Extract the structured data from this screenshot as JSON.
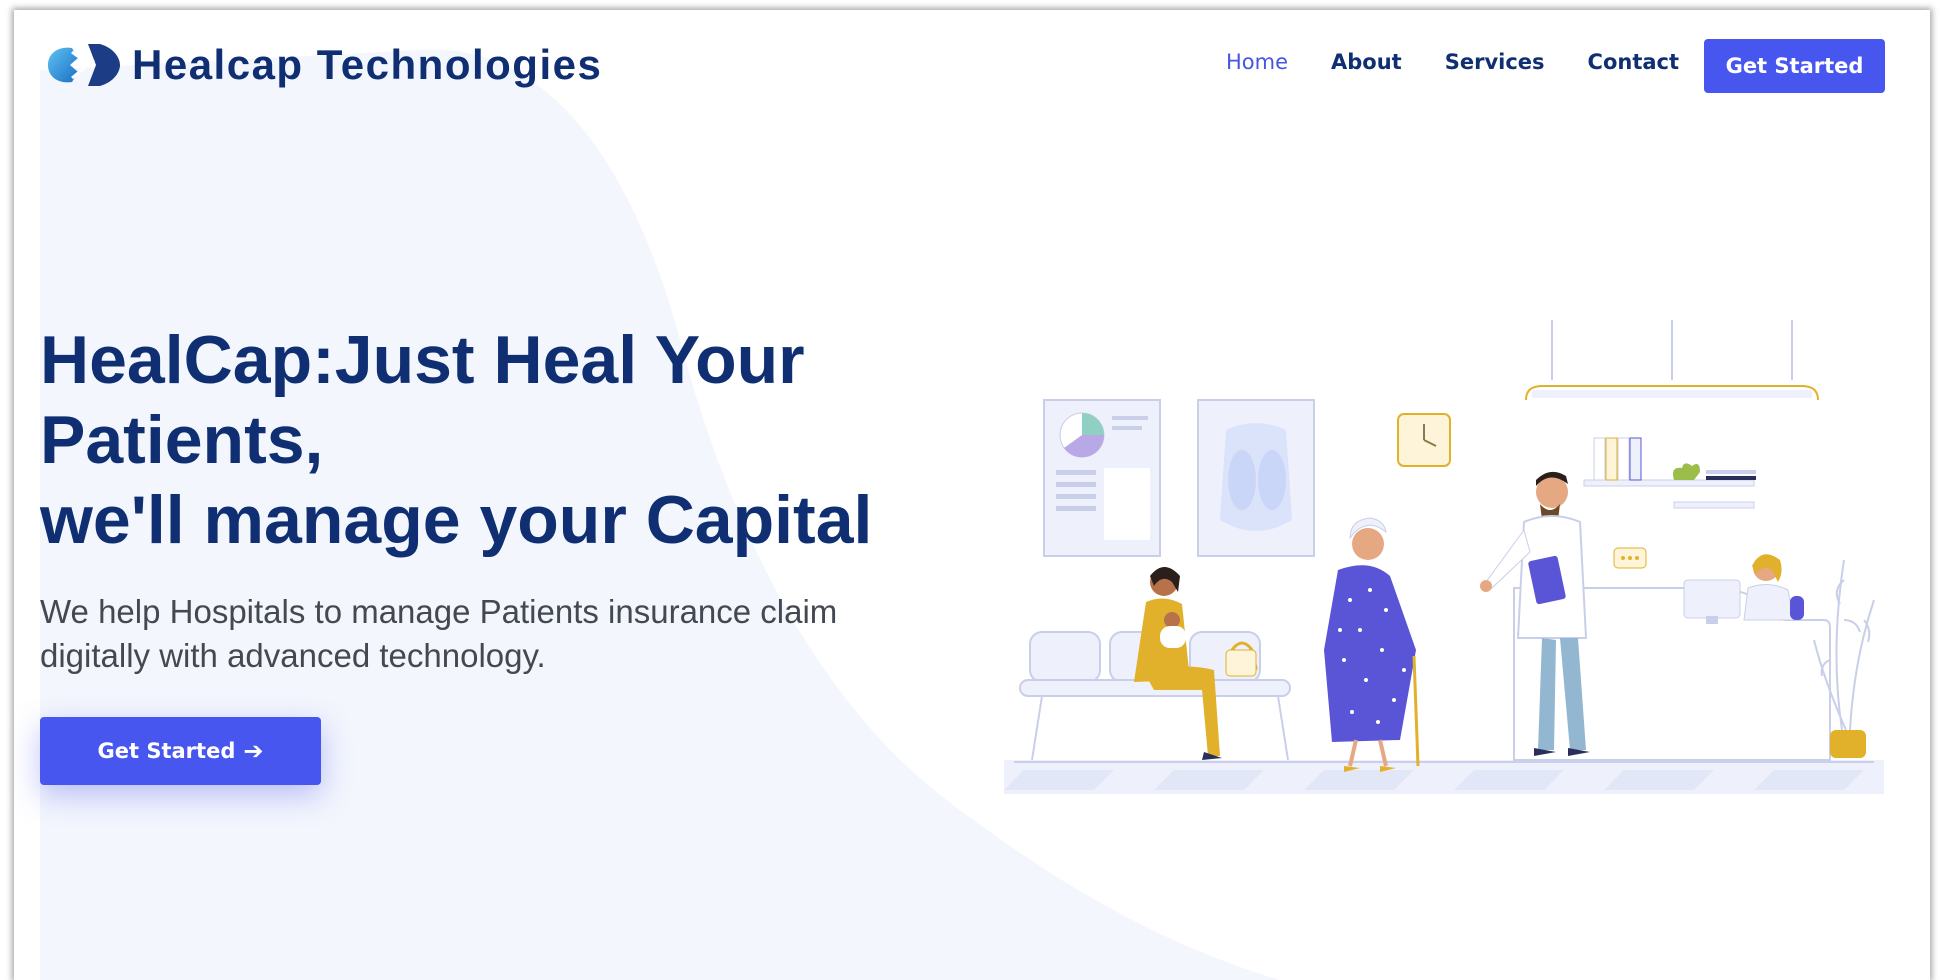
{
  "brand": {
    "name": "Healcap Technologies"
  },
  "nav": {
    "links": [
      {
        "label": "Home",
        "active": true
      },
      {
        "label": "About",
        "active": false
      },
      {
        "label": "Services",
        "active": false
      },
      {
        "label": "Contact",
        "active": false
      }
    ],
    "cta_label": "Get Started"
  },
  "hero": {
    "title_lines": [
      "HealCap:Just Heal Your",
      "Patients,",
      "we'll manage your Capital"
    ],
    "subtitle_lines": [
      "We help Hospitals to manage Patients insurance claim",
      "digitally with advanced technology."
    ],
    "cta_label": "Get Started",
    "cta_icon": "arrow-right-icon"
  },
  "colors": {
    "brand_navy": "#0f2f72",
    "accent_blue": "#4756ef",
    "hero_bg": "#f3f6fd",
    "illustration_yellow": "#e2b12c",
    "illustration_purple": "#5a55d6"
  },
  "illustration": {
    "subject": "clinic-reception-illustration"
  }
}
